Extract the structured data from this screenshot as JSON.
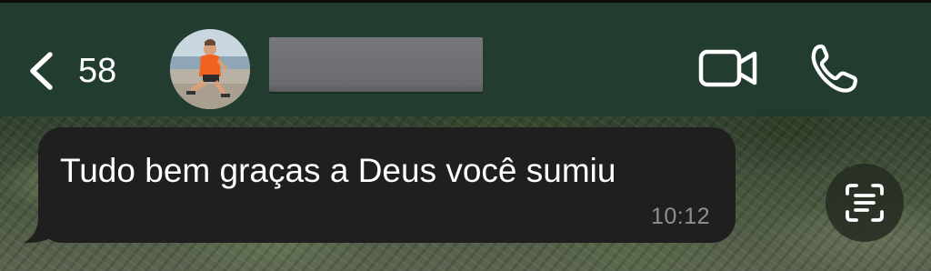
{
  "header": {
    "unread_count": "58",
    "contact_name": "",
    "back_icon": "chevron-left-icon",
    "video_icon": "video-camera-icon",
    "call_icon": "phone-icon"
  },
  "message": {
    "text": "Tudo bem graças a Deus você sumiu",
    "time": "10:12",
    "bubble_color": "#1f1f1f",
    "text_color": "#ffffff",
    "time_color": "#8f8f8f"
  },
  "actions": {
    "scan_icon": "scan-text-icon"
  },
  "colors": {
    "header_bg": "#203c30",
    "icon": "#ffffff",
    "redaction": "#6c6c70"
  }
}
